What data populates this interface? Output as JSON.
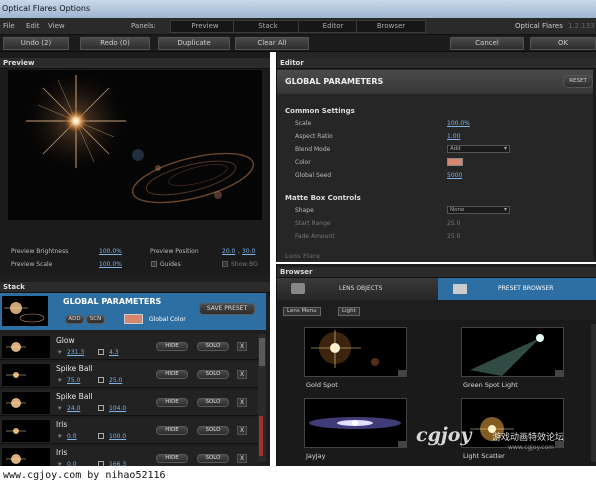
{
  "window": {
    "title": "Optical Flares Options",
    "brand": "Optical Flares",
    "version": "1.2.133"
  },
  "menu": {
    "file": "File",
    "edit": "Edit",
    "view": "View",
    "panels_label": "Panels:"
  },
  "panels": [
    "Preview",
    "Stack",
    "Editor",
    "Browser"
  ],
  "toolbar": {
    "undo": "Undo (2)",
    "redo": "Redo (0)",
    "duplicate": "Duplicate",
    "clear_all": "Clear All",
    "cancel": "Cancel",
    "ok": "OK"
  },
  "preview": {
    "title": "Preview",
    "brightness_label": "Preview Brightness",
    "brightness": "100.0%",
    "scale_label": "Preview Scale",
    "scale": "100.0%",
    "position_label": "Preview Position",
    "position_x": "20.0",
    "position_sep": ",",
    "position_y": "30.0",
    "guides": "Guides",
    "show_bg": "Show BG"
  },
  "editor": {
    "title": "Editor",
    "section": "GLOBAL PARAMETERS",
    "reset": "RESET",
    "common_title": "Common Settings",
    "scale_label": "Scale",
    "scale": "100.0%",
    "aspect_label": "Aspect Ratio",
    "aspect": "1.00",
    "blend_label": "Blend Mode",
    "blend": "Add",
    "color_label": "Color",
    "seed_label": "Global Seed",
    "seed": "5000",
    "matte_title": "Matte Box Controls",
    "shape_label": "Shape",
    "shape": "None",
    "start_label": "Start Range",
    "start": "25.0",
    "fade_label": "Fade Amount",
    "fade": "25.0",
    "cut_label": "Lens Flare"
  },
  "stack": {
    "title": "Stack",
    "global_title": "GLOBAL PARAMETERS",
    "add": "ADD",
    "scn": "SCN",
    "global_color": "Global Color",
    "save_preset": "SAVE PRESET",
    "hide": "HIDE",
    "solo": "SOLO",
    "x": "X",
    "items": [
      {
        "name": "Glow",
        "brightness": "231.3",
        "scale": "4.3"
      },
      {
        "name": "Spike Ball",
        "brightness": "75.0",
        "scale": "25.0"
      },
      {
        "name": "Spike Ball",
        "brightness": "24.0",
        "scale": "104.0"
      },
      {
        "name": "Iris",
        "brightness": "0.0",
        "scale": "100.0"
      },
      {
        "name": "Iris",
        "brightness": "0.0",
        "scale": "166.3"
      }
    ]
  },
  "browser": {
    "title": "Browser",
    "tab_lens": "LENS OBJECTS",
    "tab_preset": "PRESET BROWSER",
    "crumb_root": "Lens Menu",
    "crumb_sub": "Light",
    "presets": [
      {
        "name": "Gold Spot"
      },
      {
        "name": "Green Spot Light"
      },
      {
        "name": "JayJay"
      },
      {
        "name": "Light Scatter"
      }
    ]
  },
  "watermark": {
    "logo": "cgjoy",
    "cn_text": "游戏动画特效论坛",
    "url": "www.cgjoy.com"
  },
  "footer": {
    "text": "www.cgjoy.com by nihao52116"
  },
  "colors": {
    "accent_blue": "#2e6fa3",
    "link": "#7fb2e5",
    "swatch": "#d6856e",
    "flare": "#ffb46a"
  }
}
